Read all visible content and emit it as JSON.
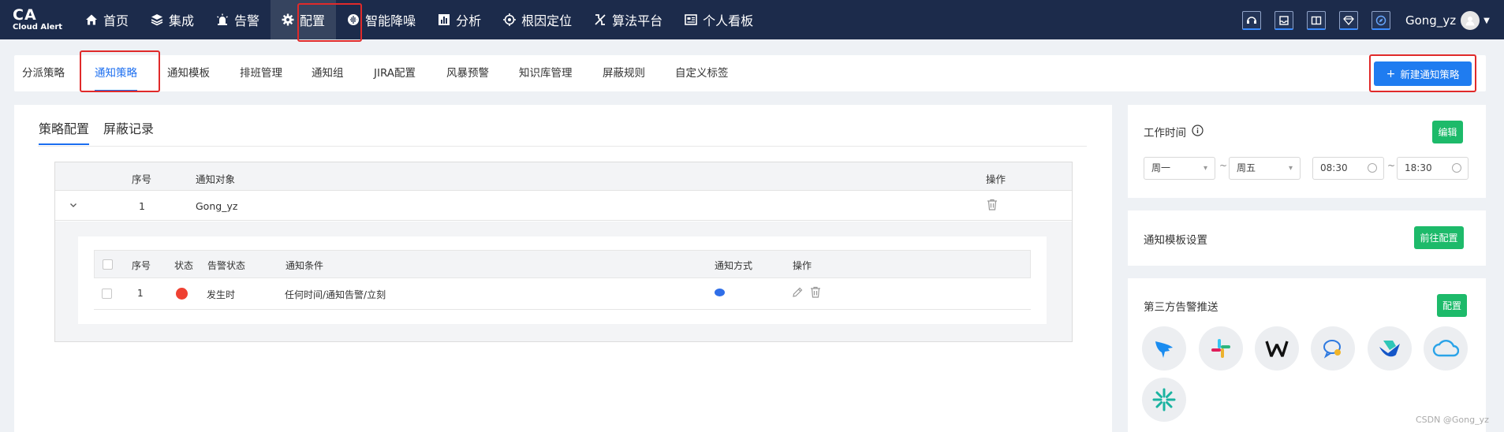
{
  "app": {
    "logo_main": "CA",
    "logo_sub": "Cloud Alert"
  },
  "nav": [
    {
      "label": "首页",
      "icon": "home-icon"
    },
    {
      "label": "集成",
      "icon": "layers-icon"
    },
    {
      "label": "告警",
      "icon": "alarm-icon"
    },
    {
      "label": "配置",
      "icon": "gear-icon",
      "active": true
    },
    {
      "label": "智能降噪",
      "icon": "noise-icon"
    },
    {
      "label": "分析",
      "icon": "bar-chart-icon"
    },
    {
      "label": "根因定位",
      "icon": "target-icon"
    },
    {
      "label": "算法平台",
      "icon": "algorithm-icon"
    },
    {
      "label": "个人看板",
      "icon": "dashboard-icon"
    }
  ],
  "user": {
    "name": "Gong_yz"
  },
  "subtabs": [
    "分派策略",
    "通知策略",
    "通知模板",
    "排班管理",
    "通知组",
    "JIRA配置",
    "风暴预警",
    "知识库管理",
    "屏蔽规则",
    "自定义标签"
  ],
  "subtab_active_index": 1,
  "new_button": "新建通知策略",
  "inner_tabs": {
    "policy": "策略配置",
    "mute_log": "屏蔽记录"
  },
  "table": {
    "headers": {
      "index": "序号",
      "target": "通知对象",
      "actions": "操作"
    },
    "row": {
      "index": "1",
      "target": "Gong_yz"
    }
  },
  "nested_table": {
    "headers": {
      "index": "序号",
      "status": "状态",
      "alert_status": "告警状态",
      "condition": "通知条件",
      "method": "通知方式",
      "actions": "操作"
    },
    "row": {
      "index": "1",
      "alert_status": "发生时",
      "condition": "任何时间/通知告警/立刻",
      "status_color": "#ef4132",
      "method_color": "#2f6ee8"
    }
  },
  "work_time": {
    "title": "工作时间",
    "edit": "编辑",
    "day_from": "周一",
    "day_to": "周五",
    "time_from": "08:30",
    "time_to": "18:30",
    "sep": "~"
  },
  "template_settings": {
    "title": "通知模板设置",
    "button": "前往配置"
  },
  "third_party": {
    "title": "第三方告警推送",
    "button": "配置",
    "apps": [
      "dingtalk-icon",
      "slack-icon",
      "wecom-w-icon",
      "chat-bubble-icon",
      "feishu-icon",
      "cloud-icon",
      "spark-icon"
    ]
  },
  "watermark": "CSDN @Gong_yz",
  "colors": {
    "nav_bg": "#1c2b4b",
    "accent": "#1b6ef0",
    "green": "#1dba6a",
    "highlight": "#e02a2a"
  }
}
